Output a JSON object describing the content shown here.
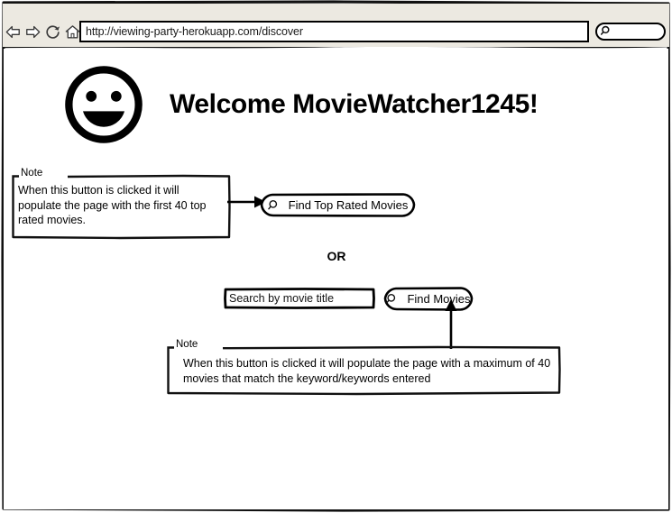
{
  "browser": {
    "nav": {
      "back_icon": "back-arrow-icon",
      "forward_icon": "forward-arrow-icon",
      "reload_icon": "reload-icon",
      "home_icon": "home-icon"
    },
    "address": {
      "url": "http://viewing-party-herokuapp.com/discover"
    },
    "toolbar_search": {
      "value": "",
      "placeholder": "",
      "icon": "search-icon"
    }
  },
  "page": {
    "avatar": {
      "icon": "smiley-face-icon"
    },
    "title": "Welcome MovieWatcher1245!",
    "or_divider": "OR",
    "top_rated_button": {
      "label": "Find Top Rated Movies",
      "icon": "search-icon"
    },
    "find_movies_button": {
      "label": "Find Movies",
      "icon": "search-icon"
    },
    "search_input": {
      "placeholder": "Search by movie title",
      "value": ""
    },
    "notes": [
      {
        "label": "Note",
        "text": "When this button is clicked it will populate the page with the first 40 top rated movies."
      },
      {
        "label": "Note",
        "text": "When this button is clicked it will populate the page with a maximum of 40 movies that match the keyword/keywords entered"
      }
    ]
  },
  "colors": {
    "toolbar_bg": "#ECE9E1",
    "page_bg": "#FFFFFF",
    "ink": "#000000"
  }
}
